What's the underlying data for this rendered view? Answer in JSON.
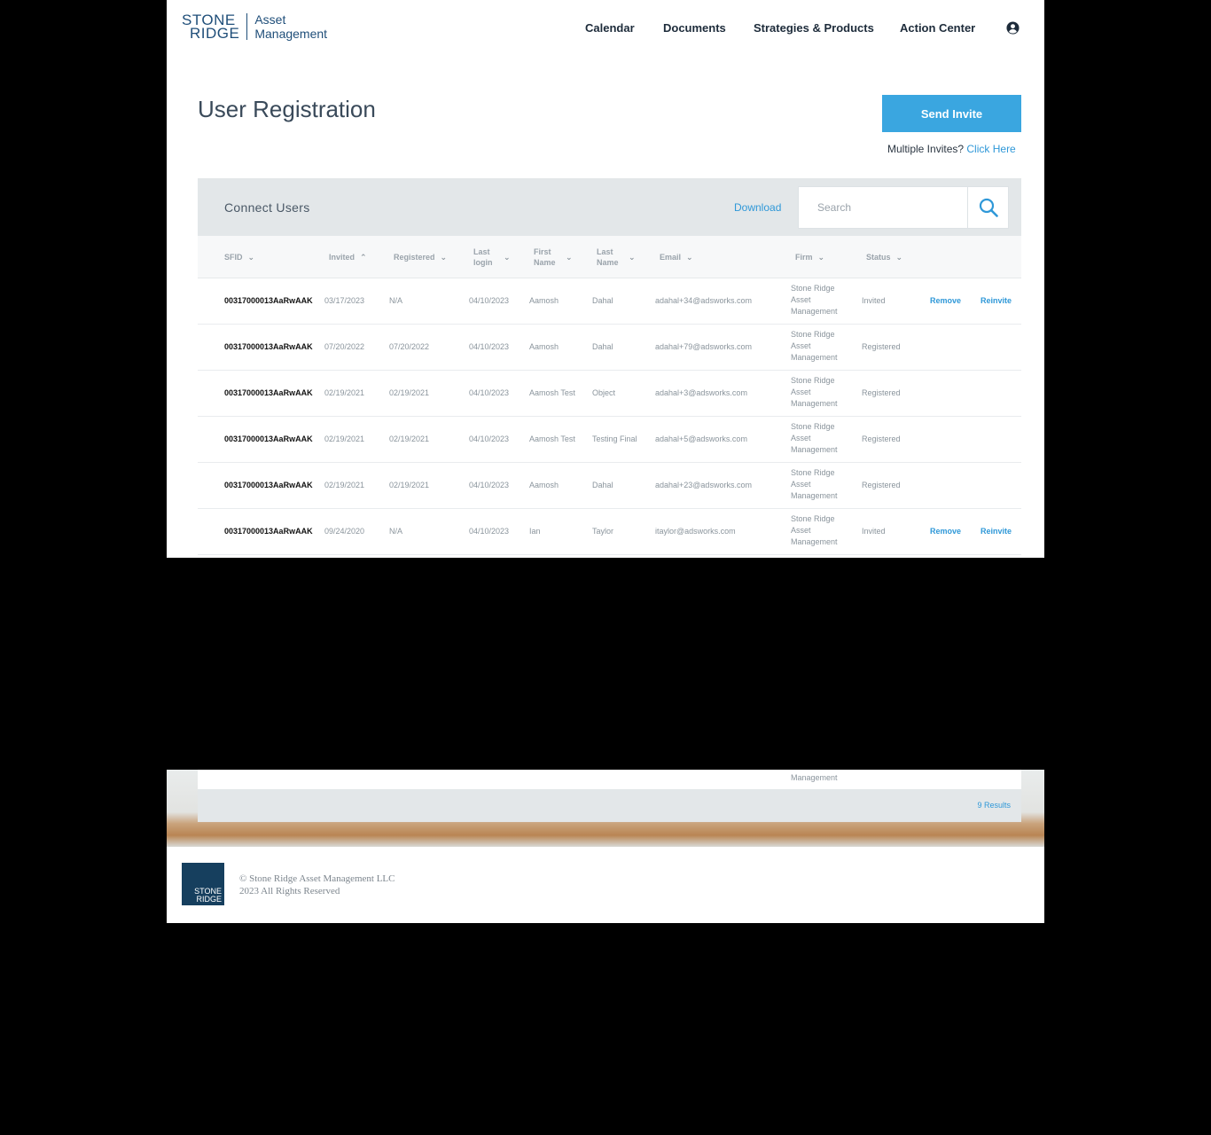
{
  "logo": {
    "line1": "STONE",
    "line2": "RIDGE",
    "sub1": "Asset",
    "sub2": "Management"
  },
  "nav": {
    "calendar": "Calendar",
    "documents": "Documents",
    "strategies": "Strategies & Products",
    "action_center": "Action Center"
  },
  "page_title": "User Registration",
  "send_invite_label": "Send Invite",
  "multiple_invites": {
    "text": "Multiple Invites?",
    "link": "Click Here"
  },
  "panel": {
    "title": "Connect Users",
    "download_label": "Download",
    "search_placeholder": "Search",
    "columns": [
      {
        "label": "SFID"
      },
      {
        "label": "Invited"
      },
      {
        "label": "Registered"
      },
      {
        "label": "Last login"
      },
      {
        "label": "First Name"
      },
      {
        "label": "Last Name"
      },
      {
        "label": "Email"
      },
      {
        "label": "Firm"
      },
      {
        "label": "Status"
      }
    ],
    "rows": [
      {
        "sfid": "00317000013AaRwAAK",
        "invited": "03/17/2023",
        "registered": "N/A",
        "last_login": "04/10/2023",
        "first": "Aamosh",
        "last": "Dahal",
        "email": "adahal+34@adsworks.com",
        "firm": "Stone Ridge Asset Management",
        "status": "Invited",
        "remove": "Remove",
        "reinvite": "Reinvite"
      },
      {
        "sfid": "00317000013AaRwAAK",
        "invited": "07/20/2022",
        "registered": "07/20/2022",
        "last_login": "04/10/2023",
        "first": "Aamosh",
        "last": "Dahal",
        "email": "adahal+79@adsworks.com",
        "firm": "Stone Ridge Asset Management",
        "status": "Registered",
        "remove": "",
        "reinvite": ""
      },
      {
        "sfid": "00317000013AaRwAAK",
        "invited": "02/19/2021",
        "registered": "02/19/2021",
        "last_login": "04/10/2023",
        "first": "Aamosh Test",
        "last": "Object",
        "email": "adahal+3@adsworks.com",
        "firm": "Stone Ridge Asset Management",
        "status": "Registered",
        "remove": "",
        "reinvite": ""
      },
      {
        "sfid": "00317000013AaRwAAK",
        "invited": "02/19/2021",
        "registered": "02/19/2021",
        "last_login": "04/10/2023",
        "first": "Aamosh Test",
        "last": "Testing Final",
        "email": "adahal+5@adsworks.com",
        "firm": "Stone Ridge Asset Management",
        "status": "Registered",
        "remove": "",
        "reinvite": ""
      },
      {
        "sfid": "00317000013AaRwAAK",
        "invited": "02/19/2021",
        "registered": "02/19/2021",
        "last_login": "04/10/2023",
        "first": "Aamosh",
        "last": "Dahal",
        "email": "adahal+23@adsworks.com",
        "firm": "Stone Ridge Asset Management",
        "status": "Registered",
        "remove": "",
        "reinvite": ""
      },
      {
        "sfid": "00317000013AaRwAAK",
        "invited": "09/24/2020",
        "registered": "N/A",
        "last_login": "04/10/2023",
        "first": "Ian",
        "last": "Taylor",
        "email": "itaylor@adsworks.com",
        "firm": "Stone Ridge Asset Management",
        "status": "Invited",
        "remove": "Remove",
        "reinvite": "Reinvite"
      }
    ],
    "partial_row_firm": "Management",
    "results": "9 Results"
  },
  "footer": {
    "line1": "© Stone Ridge Asset Management LLC",
    "line2": "2023 All Rights Reserved",
    "logo1": "STONE",
    "logo2": "RIDGE"
  },
  "colors": {
    "accent": "#3aa6e0",
    "link": "#2f98d8",
    "brand": "#163f5e",
    "panel_bg": "#e3e7e9"
  }
}
